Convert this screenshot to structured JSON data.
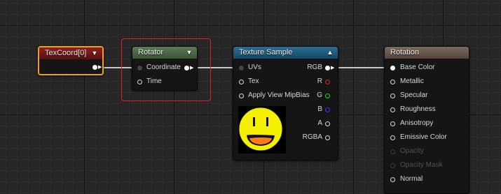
{
  "colors": {
    "texcoord_header": "#7a1a1a",
    "rotator_header": "#4f6a4a",
    "texture_header": "#1d5a7a",
    "material_header": "#6a5a4e",
    "selection_outline": "#f0a018",
    "annotation": "#e0202a"
  },
  "nodes": {
    "texcoord": {
      "title": "TexCoord[0]",
      "collapse_icon": "chevron-down-icon"
    },
    "rotator": {
      "title": "Rotator",
      "collapse_icon": "chevron-down-icon",
      "inputs": [
        "Coordinate",
        "Time"
      ]
    },
    "texture_sample": {
      "title": "Texture Sample",
      "collapse_icon": "chevron-up-icon",
      "inputs": [
        "UVs",
        "Tex",
        "Apply View MipBias"
      ],
      "outputs": [
        "RGB",
        "R",
        "G",
        "B",
        "A",
        "RGBA"
      ],
      "preview_icon": "smiley-face-texture"
    },
    "material": {
      "title": "Rotation",
      "inputs": [
        "Base Color",
        "Metallic",
        "Specular",
        "Roughness",
        "Anisotropy",
        "Emissive Color",
        "Opacity",
        "Opacity Mask",
        "Normal"
      ]
    }
  }
}
